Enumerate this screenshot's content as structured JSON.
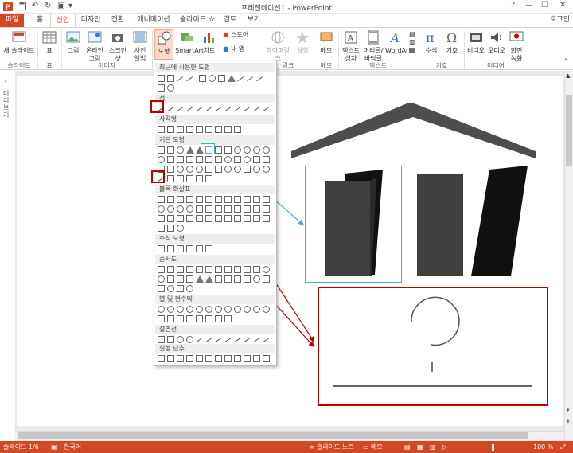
{
  "window": {
    "title": "프레젠테이션1 - PowerPoint",
    "buttons": [
      "?",
      "—",
      "☐",
      "✕"
    ]
  },
  "tabs": [
    "파일",
    "홈",
    "삽입",
    "디자인",
    "전환",
    "애니메이션",
    "슬라이드 쇼",
    "검토",
    "보기"
  ],
  "active_tab": "삽입",
  "login": "로그인",
  "ribbon": {
    "new_slide": "새 슬라이드",
    "table": "표",
    "picture": "그림",
    "online_picture": "온라인 그림",
    "screenshot": "스크린샷",
    "photo_album": "사진 앨범",
    "shapes": "도형",
    "smartart": "SmartArt",
    "chart": "차트",
    "store": "스토어",
    "my_apps": "내 앱",
    "hyperlink": "하이퍼링크",
    "action": "실행",
    "comment": "메모",
    "textbox": "텍스트 상자",
    "header_footer": "머리글/ 바닥글",
    "wordart": "WordArt",
    "equation": "수식",
    "symbol": "기호",
    "video": "비디오",
    "audio": "오디오",
    "screen_recording": "화면 녹화",
    "groups": {
      "slides": "슬라이드",
      "tables": "표",
      "images": "이미지",
      "links": "링크",
      "comments": "메모",
      "text": "텍스트",
      "symbols": "기호",
      "media": "미디어"
    }
  },
  "left_pane": {
    "arrow": "›",
    "label": "미리보기"
  },
  "shapes_menu": {
    "sections": [
      "최근에 사용한 도형",
      "선",
      "사각형",
      "기본 도형",
      "블록 화살표",
      "수식 도형",
      "순서도",
      "별 및 현수막",
      "설명선",
      "실행 단추"
    ]
  },
  "status": {
    "slide_no": "슬라이드 1/6",
    "language": "한국어",
    "notes": "슬라이드 노트",
    "comments": "메모",
    "zoom": "100 %"
  },
  "colors": {
    "accent": "#d24726",
    "highlight_red": "#c00000",
    "highlight_cyan": "#3cb4c4",
    "roof": "#4d4d4d",
    "panel_dark": "#3f3f3f",
    "panel_black": "#111111"
  }
}
